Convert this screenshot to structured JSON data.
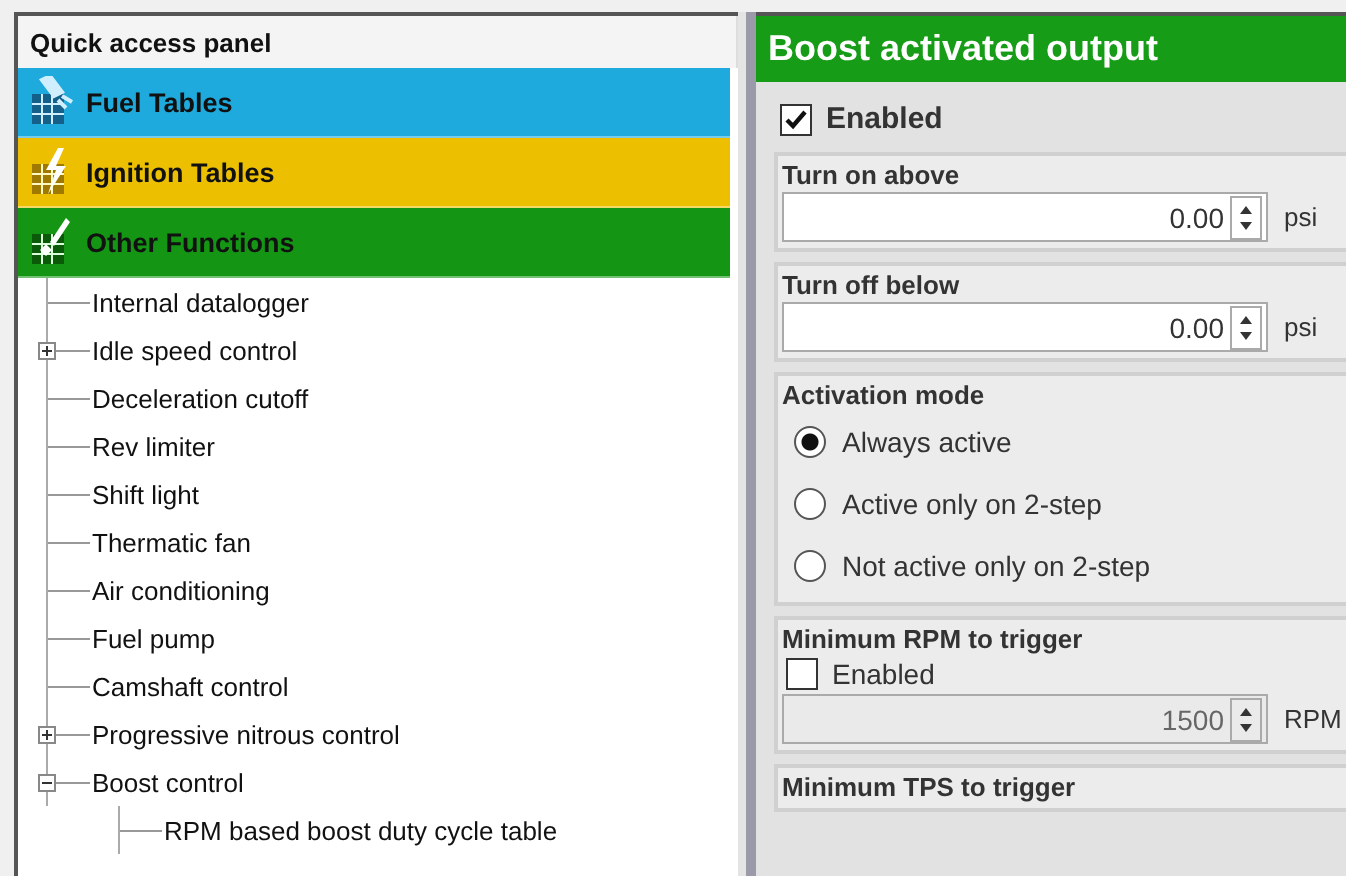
{
  "quick_access_panel": {
    "title": "Quick access panel",
    "categories": [
      {
        "label": "Fuel Tables",
        "kind": "fuel",
        "color": "#1eaadc"
      },
      {
        "label": "Ignition Tables",
        "kind": "ignition",
        "color": "#ecc000"
      },
      {
        "label": "Other Functions",
        "kind": "other",
        "color": "#149614"
      }
    ],
    "tree": [
      {
        "label": "Internal datalogger"
      },
      {
        "label": "Idle speed control",
        "expanded": false
      },
      {
        "label": "Deceleration cutoff"
      },
      {
        "label": "Rev limiter"
      },
      {
        "label": "Shift light"
      },
      {
        "label": "Thermatic fan"
      },
      {
        "label": "Air conditioning"
      },
      {
        "label": "Fuel pump"
      },
      {
        "label": "Camshaft control"
      },
      {
        "label": "Progressive nitrous control",
        "expanded": false
      },
      {
        "label": "Boost control",
        "expanded": true,
        "children": [
          {
            "label": "RPM based boost duty cycle table"
          }
        ]
      }
    ]
  },
  "settings_panel": {
    "title": "Boost activated output",
    "enabled": {
      "label": "Enabled",
      "checked": true
    },
    "turn_on_above": {
      "label": "Turn on above",
      "value": "0.00",
      "unit": "psi"
    },
    "turn_off_below": {
      "label": "Turn off below",
      "value": "0.00",
      "unit": "psi"
    },
    "activation_mode": {
      "label": "Activation mode",
      "options": [
        {
          "label": "Always active",
          "selected": true
        },
        {
          "label": "Active only on 2-step",
          "selected": false
        },
        {
          "label": "Not active only on 2-step",
          "selected": false
        }
      ]
    },
    "minimum_rpm": {
      "label": "Minimum RPM to trigger",
      "enabled": {
        "label": "Enabled",
        "checked": false
      },
      "value": "1500",
      "unit": "RPM"
    },
    "minimum_tps": {
      "label": "Minimum TPS to trigger"
    }
  }
}
